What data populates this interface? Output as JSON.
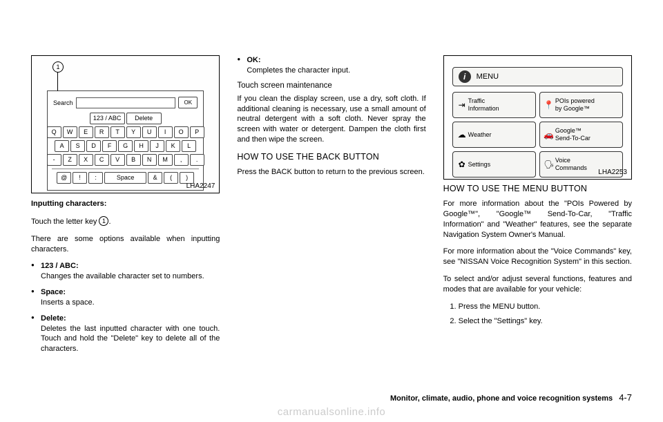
{
  "fig1": {
    "label": "LHA2247",
    "callout": "1",
    "search_label": "Search",
    "ok": "OK",
    "mode_key": "123 / ABC",
    "delete_key": "Delete",
    "row1": [
      "Q",
      "W",
      "E",
      "R",
      "T",
      "Y",
      "U",
      "I",
      "O",
      "P"
    ],
    "row2": [
      "A",
      "S",
      "D",
      "F",
      "G",
      "H",
      "J",
      "K",
      "L"
    ],
    "row3": [
      "-",
      "Z",
      "X",
      "C",
      "V",
      "B",
      "N",
      "M",
      ",",
      "."
    ],
    "row4_left": [
      "@",
      "!",
      ":"
    ],
    "space": "Space",
    "row4_right": [
      "&",
      "(",
      ")"
    ]
  },
  "col1": {
    "h_input": "Inputting characters:",
    "p_touch": "Touch the letter key ",
    "p_touch_num": "1",
    "p_touch_after": ".",
    "p_options": "There are some options available when inputting characters.",
    "b1_t": "123 / ABC:",
    "b1_d": "Changes the available character set to numbers.",
    "b2_t": "Space:",
    "b2_d": "Inserts a space.",
    "b3_t": "Delete:",
    "b3_d": "Deletes the last inputted character with one touch. Touch and hold the \"Delete\" key to delete all of the characters."
  },
  "col2": {
    "b4_t": "OK:",
    "b4_d": "Completes the character input.",
    "h_touch": "Touch screen maintenance",
    "p_touch1": "If you clean the display screen, use a dry, soft cloth. If additional cleaning is necessary, use a small amount of neutral detergent with a soft cloth. Never spray the screen with water or detergent. Dampen the cloth first and then wipe the screen.",
    "h_back": "HOW TO USE THE BACK BUTTON",
    "p_back": "Press the BACK button to return to the previous screen."
  },
  "fig2": {
    "label": "LHA2253",
    "title": "MENU",
    "items": [
      {
        "icon": "⇥",
        "text": "Traffic\nInformation"
      },
      {
        "icon": "📍",
        "text": "POIs powered\nby Google™"
      },
      {
        "icon": "☁",
        "text": "Weather"
      },
      {
        "icon": "🚗",
        "text": "Google™\nSend-To-Car"
      },
      {
        "icon": "✿",
        "text": "Settings"
      },
      {
        "icon": "🗣",
        "text": "Voice\nCommands"
      }
    ]
  },
  "col3": {
    "h_menu": "HOW TO USE THE MENU BUTTON",
    "p1": "For more information about the \"POIs Powered by Google™\", \"Google™ Send-To-Car, \"Traffic Information\" and \"Weather\" features, see the separate Navigation System Owner's Manual.",
    "p2": "For more information about the \"Voice Commands\" key, see \"NISSAN Voice Recognition System\" in this section.",
    "p3": "To select and/or adjust several functions, features and modes that are available for your vehicle:",
    "s1": "Press the MENU button.",
    "s2": "Select the \"Settings\" key."
  },
  "footer": {
    "chapter": "Monitor, climate, audio, phone and voice recognition systems",
    "page": "4-7"
  },
  "watermark": "carmanualsonline.info"
}
